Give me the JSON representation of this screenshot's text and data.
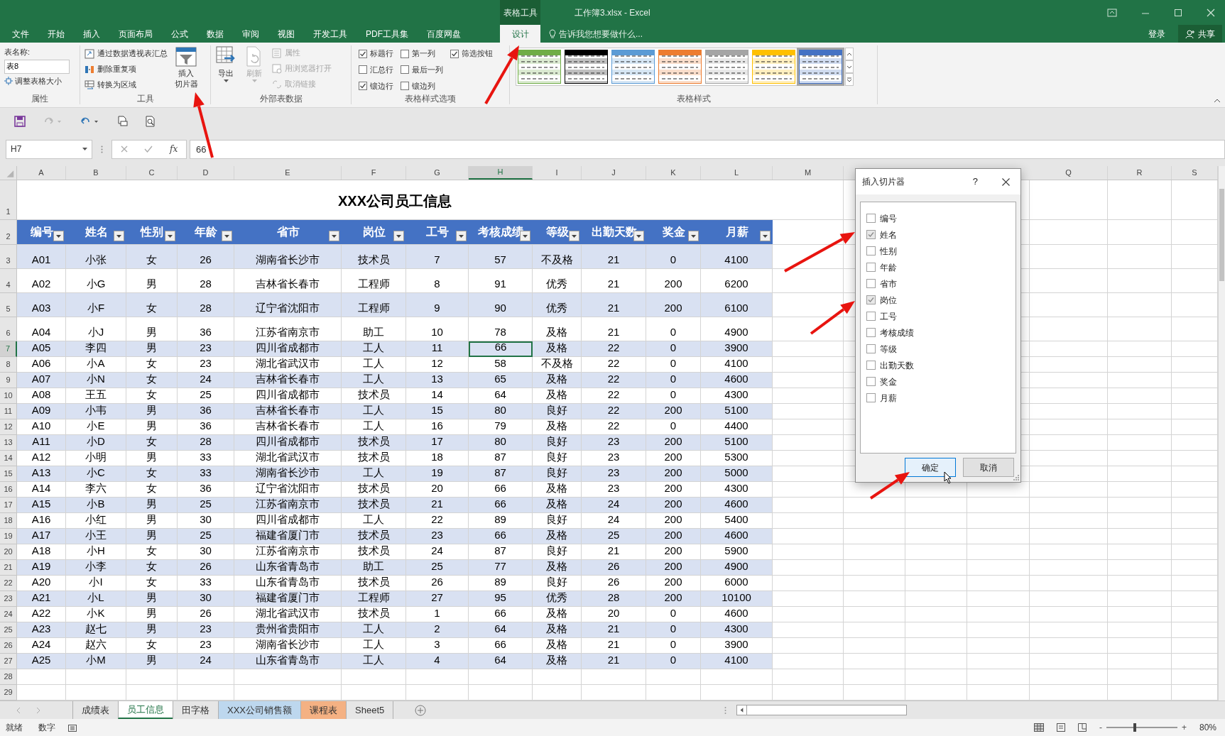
{
  "window": {
    "context_label": "表格工具",
    "title": "工作簿3.xlsx - Excel"
  },
  "ribbon_tabs": [
    {
      "label": "文件",
      "selected": false
    },
    {
      "label": "开始",
      "selected": false
    },
    {
      "label": "插入",
      "selected": false
    },
    {
      "label": "页面布局",
      "selected": false
    },
    {
      "label": "公式",
      "selected": false
    },
    {
      "label": "数据",
      "selected": false
    },
    {
      "label": "审阅",
      "selected": false
    },
    {
      "label": "视图",
      "selected": false
    },
    {
      "label": "开发工具",
      "selected": false
    },
    {
      "label": "PDF工具集",
      "selected": false
    },
    {
      "label": "百度网盘",
      "selected": false
    },
    {
      "label": "设计",
      "selected": true
    }
  ],
  "tell_me": "告诉我您想要做什么...",
  "account": {
    "sign_in": "登录",
    "share": "共享"
  },
  "ribbon": {
    "properties": {
      "label": "属性",
      "table_name_label": "表名称:",
      "table_name": "表8",
      "resize": "调整表格大小"
    },
    "tools": {
      "label": "工具",
      "items": [
        "通过数据透视表汇总",
        "删除重复项",
        "转换为区域"
      ],
      "slicer": [
        "插入",
        "切片器"
      ]
    },
    "external": {
      "label": "外部表数据",
      "export": "导出",
      "refresh": {
        "label": "刷新",
        "disabled": true
      },
      "items": [
        {
          "label": "属性",
          "disabled": true
        },
        {
          "label": "用浏览器打开",
          "disabled": true
        },
        {
          "label": "取消链接",
          "disabled": true
        }
      ]
    },
    "style_options": {
      "label": "表格样式选项",
      "options": [
        {
          "label": "标题行",
          "checked": true
        },
        {
          "label": "汇总行",
          "checked": false
        },
        {
          "label": "镶边行",
          "checked": true
        },
        {
          "label": "第一列",
          "checked": false
        },
        {
          "label": "最后一列",
          "checked": false
        },
        {
          "label": "镶边列",
          "checked": false
        },
        {
          "label": "筛选按钮",
          "checked": true
        }
      ]
    },
    "table_styles": {
      "label": "表格样式",
      "swatches": [
        {
          "color": "#70ad47",
          "selected": false
        },
        {
          "color": "#000000",
          "selected": false
        },
        {
          "color": "#5b9bd5",
          "selected": false
        },
        {
          "color": "#ed7d31",
          "selected": false
        },
        {
          "color": "#a5a5a5",
          "selected": false
        },
        {
          "color": "#ffc000",
          "selected": false
        },
        {
          "color": "#4472c4",
          "selected": true
        }
      ]
    }
  },
  "quick_access": [
    {
      "kind": "save",
      "disabled": false
    },
    {
      "kind": "redo",
      "disabled": true
    },
    {
      "kind": "undo",
      "disabled": false
    },
    {
      "kind": "print",
      "disabled": false
    },
    {
      "kind": "preview",
      "disabled": false
    }
  ],
  "formula_bar": {
    "name_box": "H7",
    "function_label": "fx",
    "value": "66"
  },
  "sheet": {
    "columns": [
      {
        "letter": "A",
        "selected": false
      },
      {
        "letter": "B",
        "selected": false
      },
      {
        "letter": "C",
        "selected": false
      },
      {
        "letter": "D",
        "selected": false
      },
      {
        "letter": "E",
        "selected": false
      },
      {
        "letter": "F",
        "selected": false
      },
      {
        "letter": "G",
        "selected": false
      },
      {
        "letter": "H",
        "selected": true
      },
      {
        "letter": "I",
        "selected": false
      },
      {
        "letter": "J",
        "selected": false
      },
      {
        "letter": "K",
        "selected": false
      },
      {
        "letter": "L",
        "selected": false
      },
      {
        "letter": "M",
        "selected": false
      },
      {
        "letter": "Q",
        "selected": false
      },
      {
        "letter": "R",
        "selected": false
      },
      {
        "letter": "S",
        "selected": false
      }
    ],
    "row_headers": [
      {
        "label": "1",
        "selected": false
      },
      {
        "label": "2",
        "selected": false
      },
      {
        "label": "3",
        "selected": false
      },
      {
        "label": "4",
        "selected": false
      },
      {
        "label": "5",
        "selected": false
      },
      {
        "label": "6",
        "selected": false
      },
      {
        "label": "7",
        "selected": true
      },
      {
        "label": "8",
        "selected": false
      },
      {
        "label": "9",
        "selected": false
      },
      {
        "label": "10",
        "selected": false
      },
      {
        "label": "11",
        "selected": false
      },
      {
        "label": "12",
        "selected": false
      },
      {
        "label": "13",
        "selected": false
      },
      {
        "label": "14",
        "selected": false
      },
      {
        "label": "15",
        "selected": false
      },
      {
        "label": "16",
        "selected": false
      },
      {
        "label": "17",
        "selected": false
      },
      {
        "label": "18",
        "selected": false
      },
      {
        "label": "19",
        "selected": false
      },
      {
        "label": "20",
        "selected": false
      },
      {
        "label": "21",
        "selected": false
      },
      {
        "label": "22",
        "selected": false
      },
      {
        "label": "23",
        "selected": false
      },
      {
        "label": "24",
        "selected": false
      },
      {
        "label": "25",
        "selected": false
      },
      {
        "label": "26",
        "selected": false
      },
      {
        "label": "27",
        "selected": false
      },
      {
        "label": "28",
        "selected": false
      },
      {
        "label": "29",
        "selected": false
      }
    ],
    "title": "XXX公司员工信息",
    "headers": [
      "编号",
      "姓名",
      "性别",
      "年龄",
      "省市",
      "岗位",
      "工号",
      "考核成绩",
      "等级",
      "出勤天数",
      "奖金",
      "月薪"
    ],
    "rows": [
      [
        "A01",
        "小张",
        "女",
        "26",
        "湖南省长沙市",
        "技术员",
        "7",
        "57",
        "不及格",
        "21",
        "0",
        "4100"
      ],
      [
        "A02",
        "小G",
        "男",
        "28",
        "吉林省长春市",
        "工程师",
        "8",
        "91",
        "优秀",
        "21",
        "200",
        "6200"
      ],
      [
        "A03",
        "小F",
        "女",
        "28",
        "辽宁省沈阳市",
        "工程师",
        "9",
        "90",
        "优秀",
        "21",
        "200",
        "6100"
      ],
      [
        "A04",
        "小J",
        "男",
        "36",
        "江苏省南京市",
        "助工",
        "10",
        "78",
        "及格",
        "21",
        "0",
        "4900"
      ],
      [
        "A05",
        "李四",
        "男",
        "23",
        "四川省成都市",
        "工人",
        "11",
        "66",
        "及格",
        "22",
        "0",
        "3900"
      ],
      [
        "A06",
        "小A",
        "女",
        "23",
        "湖北省武汉市",
        "工人",
        "12",
        "58",
        "不及格",
        "22",
        "0",
        "4100"
      ],
      [
        "A07",
        "小N",
        "女",
        "24",
        "吉林省长春市",
        "工人",
        "13",
        "65",
        "及格",
        "22",
        "0",
        "4600"
      ],
      [
        "A08",
        "王五",
        "女",
        "25",
        "四川省成都市",
        "技术员",
        "14",
        "64",
        "及格",
        "22",
        "0",
        "4300"
      ],
      [
        "A09",
        "小韦",
        "男",
        "36",
        "吉林省长春市",
        "工人",
        "15",
        "80",
        "良好",
        "22",
        "200",
        "5100"
      ],
      [
        "A10",
        "小E",
        "男",
        "36",
        "吉林省长春市",
        "工人",
        "16",
        "79",
        "及格",
        "22",
        "0",
        "4400"
      ],
      [
        "A11",
        "小D",
        "女",
        "28",
        "四川省成都市",
        "技术员",
        "17",
        "80",
        "良好",
        "23",
        "200",
        "5100"
      ],
      [
        "A12",
        "小明",
        "男",
        "33",
        "湖北省武汉市",
        "技术员",
        "18",
        "87",
        "良好",
        "23",
        "200",
        "5300"
      ],
      [
        "A13",
        "小C",
        "女",
        "33",
        "湖南省长沙市",
        "工人",
        "19",
        "87",
        "良好",
        "23",
        "200",
        "5000"
      ],
      [
        "A14",
        "李六",
        "女",
        "36",
        "辽宁省沈阳市",
        "技术员",
        "20",
        "66",
        "及格",
        "23",
        "200",
        "4300"
      ],
      [
        "A15",
        "小B",
        "男",
        "25",
        "江苏省南京市",
        "技术员",
        "21",
        "66",
        "及格",
        "24",
        "200",
        "4600"
      ],
      [
        "A16",
        "小红",
        "男",
        "30",
        "四川省成都市",
        "工人",
        "22",
        "89",
        "良好",
        "24",
        "200",
        "5400"
      ],
      [
        "A17",
        "小王",
        "男",
        "25",
        "福建省厦门市",
        "技术员",
        "23",
        "66",
        "及格",
        "25",
        "200",
        "4600"
      ],
      [
        "A18",
        "小H",
        "女",
        "30",
        "江苏省南京市",
        "技术员",
        "24",
        "87",
        "良好",
        "21",
        "200",
        "5900"
      ],
      [
        "A19",
        "小李",
        "女",
        "26",
        "山东省青岛市",
        "助工",
        "25",
        "77",
        "及格",
        "26",
        "200",
        "4900"
      ],
      [
        "A20",
        "小I",
        "女",
        "33",
        "山东省青岛市",
        "技术员",
        "26",
        "89",
        "良好",
        "26",
        "200",
        "6000"
      ],
      [
        "A21",
        "小L",
        "男",
        "30",
        "福建省厦门市",
        "工程师",
        "27",
        "95",
        "优秀",
        "28",
        "200",
        "10100"
      ],
      [
        "A22",
        "小K",
        "男",
        "26",
        "湖北省武汉市",
        "技术员",
        "1",
        "66",
        "及格",
        "20",
        "0",
        "4600"
      ],
      [
        "A23",
        "赵七",
        "男",
        "23",
        "贵州省贵阳市",
        "工人",
        "2",
        "64",
        "及格",
        "21",
        "0",
        "4300"
      ],
      [
        "A24",
        "赵六",
        "女",
        "23",
        "湖南省长沙市",
        "工人",
        "3",
        "66",
        "及格",
        "21",
        "0",
        "3900"
      ],
      [
        "A25",
        "小M",
        "男",
        "24",
        "山东省青岛市",
        "工人",
        "4",
        "64",
        "及格",
        "21",
        "0",
        "4100"
      ]
    ]
  },
  "dialog": {
    "title": "插入切片器",
    "help": "?",
    "fields": [
      {
        "label": "编号",
        "checked": false
      },
      {
        "label": "姓名",
        "checked": true
      },
      {
        "label": "性别",
        "checked": false
      },
      {
        "label": "年龄",
        "checked": false
      },
      {
        "label": "省市",
        "checked": false
      },
      {
        "label": "岗位",
        "checked": true
      },
      {
        "label": "工号",
        "checked": false
      },
      {
        "label": "考核成绩",
        "checked": false
      },
      {
        "label": "等级",
        "checked": false
      },
      {
        "label": "出勤天数",
        "checked": false
      },
      {
        "label": "奖金",
        "checked": false
      },
      {
        "label": "月薪",
        "checked": false
      }
    ],
    "ok": "确定",
    "cancel": "取消"
  },
  "sheet_tabs": [
    {
      "label": "成绩表",
      "selected": false
    },
    {
      "label": "员工信息",
      "selected": true
    },
    {
      "label": "田字格",
      "selected": false
    },
    {
      "label": "XXX公司销售额",
      "selected": false,
      "color": "#bdd7ee"
    },
    {
      "label": "课程表",
      "selected": false,
      "color": "#f4b183"
    },
    {
      "label": "Sheet5",
      "selected": false
    }
  ],
  "status_bar": {
    "ready": "就绪",
    "mode": "数字",
    "zoom_out": "-",
    "zoom_slider": {
      "level": 0.4
    },
    "zoom_in": "+",
    "zoom": "80%"
  }
}
